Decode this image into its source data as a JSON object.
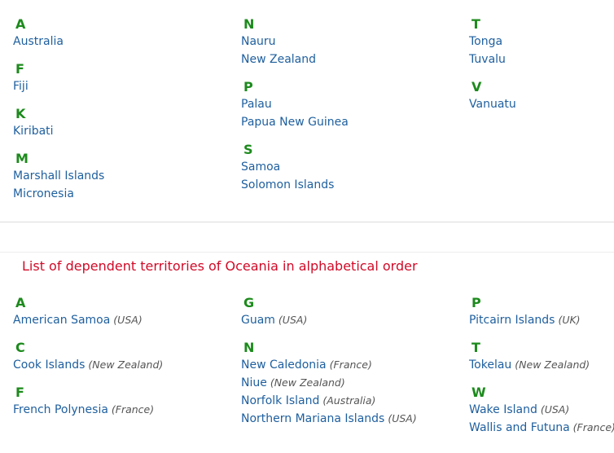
{
  "countries": {
    "columns": [
      [
        {
          "letter": "A",
          "items": [
            {
              "name": "Australia"
            }
          ]
        },
        {
          "letter": "F",
          "items": [
            {
              "name": "Fiji"
            }
          ]
        },
        {
          "letter": "K",
          "items": [
            {
              "name": "Kiribati"
            }
          ]
        },
        {
          "letter": "M",
          "items": [
            {
              "name": "Marshall Islands"
            },
            {
              "name": "Micronesia"
            }
          ]
        }
      ],
      [
        {
          "letter": "N",
          "items": [
            {
              "name": "Nauru"
            },
            {
              "name": "New Zealand"
            }
          ]
        },
        {
          "letter": "P",
          "items": [
            {
              "name": "Palau"
            },
            {
              "name": "Papua New Guinea"
            }
          ]
        },
        {
          "letter": "S",
          "items": [
            {
              "name": "Samoa"
            },
            {
              "name": "Solomon Islands"
            }
          ]
        }
      ],
      [
        {
          "letter": "T",
          "items": [
            {
              "name": "Tonga"
            },
            {
              "name": "Tuvalu"
            }
          ]
        },
        {
          "letter": "V",
          "items": [
            {
              "name": "Vanuatu"
            }
          ]
        }
      ]
    ]
  },
  "territories": {
    "heading": "List of dependent territories of Oceania in alphabetical order",
    "columns": [
      [
        {
          "letter": "A",
          "items": [
            {
              "name": "American Samoa",
              "note": "(USA)"
            }
          ]
        },
        {
          "letter": "C",
          "items": [
            {
              "name": "Cook Islands",
              "note": "(New Zealand)"
            }
          ]
        },
        {
          "letter": "F",
          "items": [
            {
              "name": "French Polynesia",
              "note": "(France)"
            }
          ]
        }
      ],
      [
        {
          "letter": "G",
          "items": [
            {
              "name": "Guam",
              "note": "(USA)"
            }
          ]
        },
        {
          "letter": "N",
          "items": [
            {
              "name": "New Caledonia",
              "note": "(France)"
            },
            {
              "name": "Niue",
              "note": "(New Zealand)"
            },
            {
              "name": "Norfolk Island",
              "note": "(Australia)"
            },
            {
              "name": "Northern Mariana Islands",
              "note": "(USA)"
            }
          ]
        }
      ],
      [
        {
          "letter": "P",
          "items": [
            {
              "name": "Pitcairn Islands",
              "note": "(UK)"
            }
          ]
        },
        {
          "letter": "T",
          "items": [
            {
              "name": "Tokelau",
              "note": "(New Zealand)"
            }
          ]
        },
        {
          "letter": "W",
          "items": [
            {
              "name": "Wake Island",
              "note": "(USA)"
            },
            {
              "name": "Wallis and Futuna",
              "note": "(France)"
            }
          ]
        }
      ]
    ]
  }
}
